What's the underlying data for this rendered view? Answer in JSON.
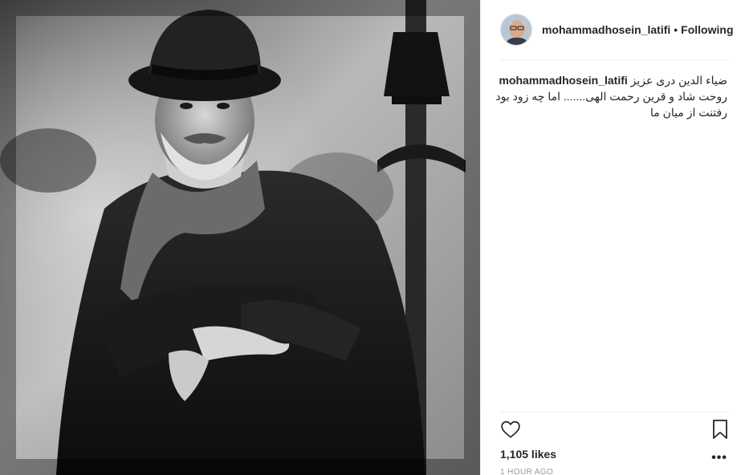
{
  "post": {
    "username": "mohammadhosein_latifi",
    "separator": "•",
    "follow_status": "Following",
    "caption_first": "ضیاء الدین دری عزیز",
    "caption_lines": [
      "روحت شاد و قرین رحمت الهی....... اما چه زود بود",
      "رفتنت از میان ما"
    ],
    "likes": "1,105 likes",
    "time": "1 HOUR AGO",
    "more_label": "•••"
  },
  "icons": {
    "like": "heart-icon",
    "save": "bookmark-icon",
    "more": "more-options-icon"
  },
  "colors": {
    "text": "#262626",
    "muted": "#999999",
    "divider": "#efefef"
  }
}
